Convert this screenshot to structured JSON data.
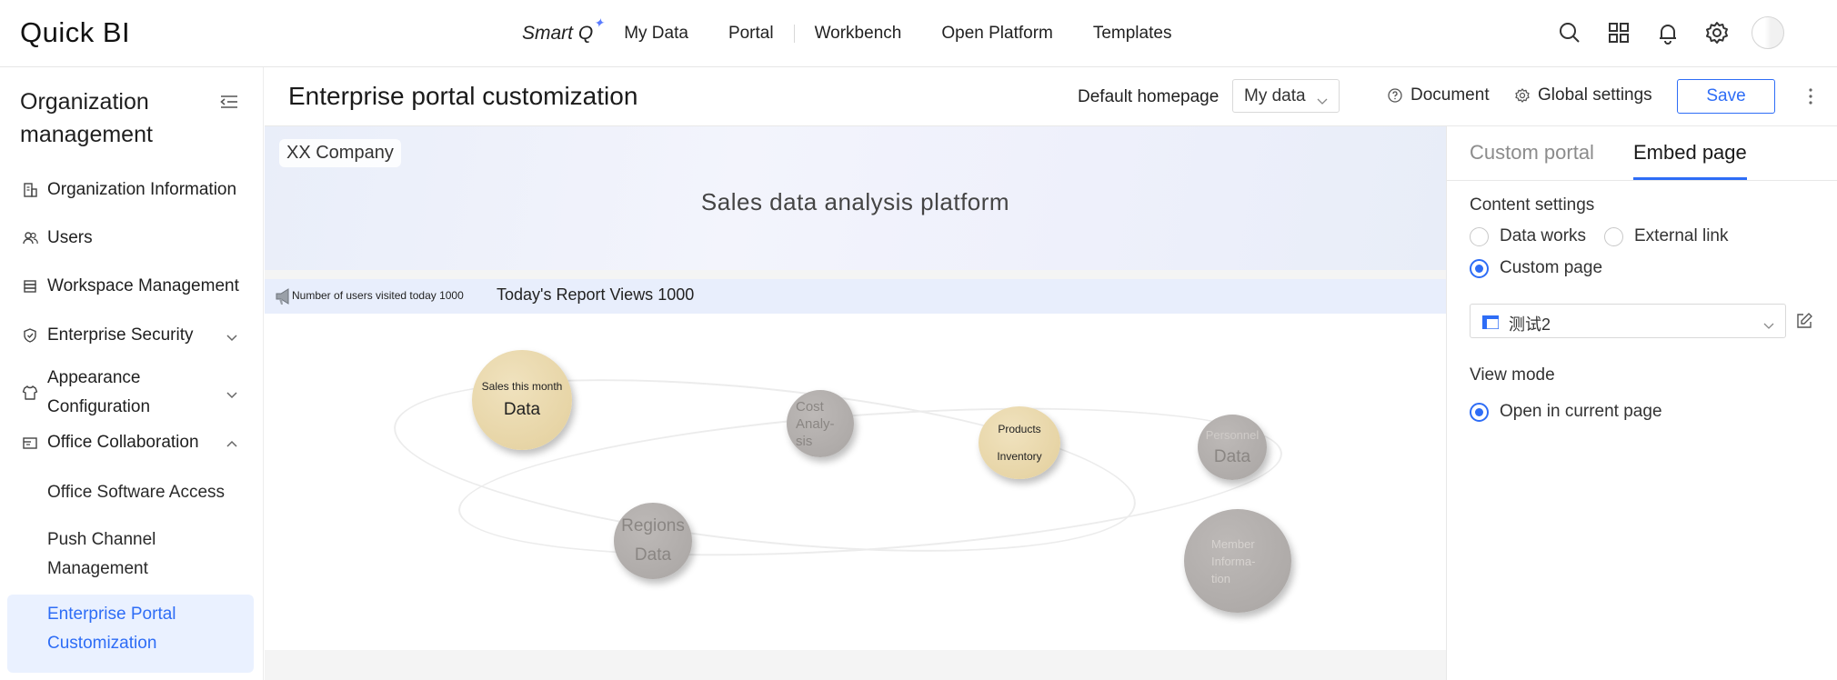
{
  "app": {
    "logo_text": "Quick BI"
  },
  "topnav": {
    "smartq": "Smart Q",
    "items": [
      "My Data",
      "Portal",
      "Workbench",
      "Open Platform",
      "Templates"
    ]
  },
  "topicons": [
    "search-icon",
    "apps-grid-icon",
    "bell-icon",
    "gear-icon",
    "avatar"
  ],
  "sidebar": {
    "title": "Organization management",
    "items": [
      {
        "label": "Organization Information",
        "icon": "building-icon"
      },
      {
        "label": "Users",
        "icon": "users-icon"
      },
      {
        "label": "Workspace Management",
        "icon": "database-icon"
      },
      {
        "label": "Enterprise Security",
        "icon": "shield-icon"
      },
      {
        "label": "Appearance Configuration",
        "icon": "shirt-icon"
      },
      {
        "label": "Office Collaboration",
        "icon": "briefcase-icon"
      }
    ],
    "subitems": [
      "Office Software Access",
      "Push Channel Management",
      "Enterprise Portal Customization"
    ]
  },
  "header": {
    "title": "Enterprise portal customization",
    "default_homepage_label": "Default homepage",
    "default_homepage_value": "My data",
    "document_label": "Document",
    "global_settings_label": "Global settings",
    "save_label": "Save"
  },
  "canvas": {
    "company": "XX Company",
    "platform_title": "Sales data analysis platform",
    "ticker_users": "Number of users visited today 1000",
    "ticker_views": "Today's Report Views 1000",
    "bubbles": [
      {
        "line1": "Sales this month",
        "line2": "Data"
      },
      {
        "line1": "Cost Analy-sis",
        "line2": ""
      },
      {
        "line1": "Products",
        "line2": "Inventory"
      },
      {
        "line1": "Personnel",
        "line2": "Data"
      },
      {
        "line1": "Regions",
        "line2": "Data"
      },
      {
        "line1": "Member Informa-tion",
        "line2": ""
      }
    ]
  },
  "rpanel": {
    "tabs": [
      "Custom portal",
      "Embed page"
    ],
    "content_settings_label": "Content settings",
    "radio_data_works": "Data works",
    "radio_external_link": "External link",
    "radio_custom_page": "Custom page",
    "selected_page": "测试2",
    "view_mode_label": "View mode",
    "radio_open_current": "Open in current page"
  },
  "colors": {
    "accent": "#2e6df6",
    "active_bg": "#eaf1ff",
    "bubble_tan": "#e8d6a8",
    "bubble_grey": "#b0acaa"
  }
}
